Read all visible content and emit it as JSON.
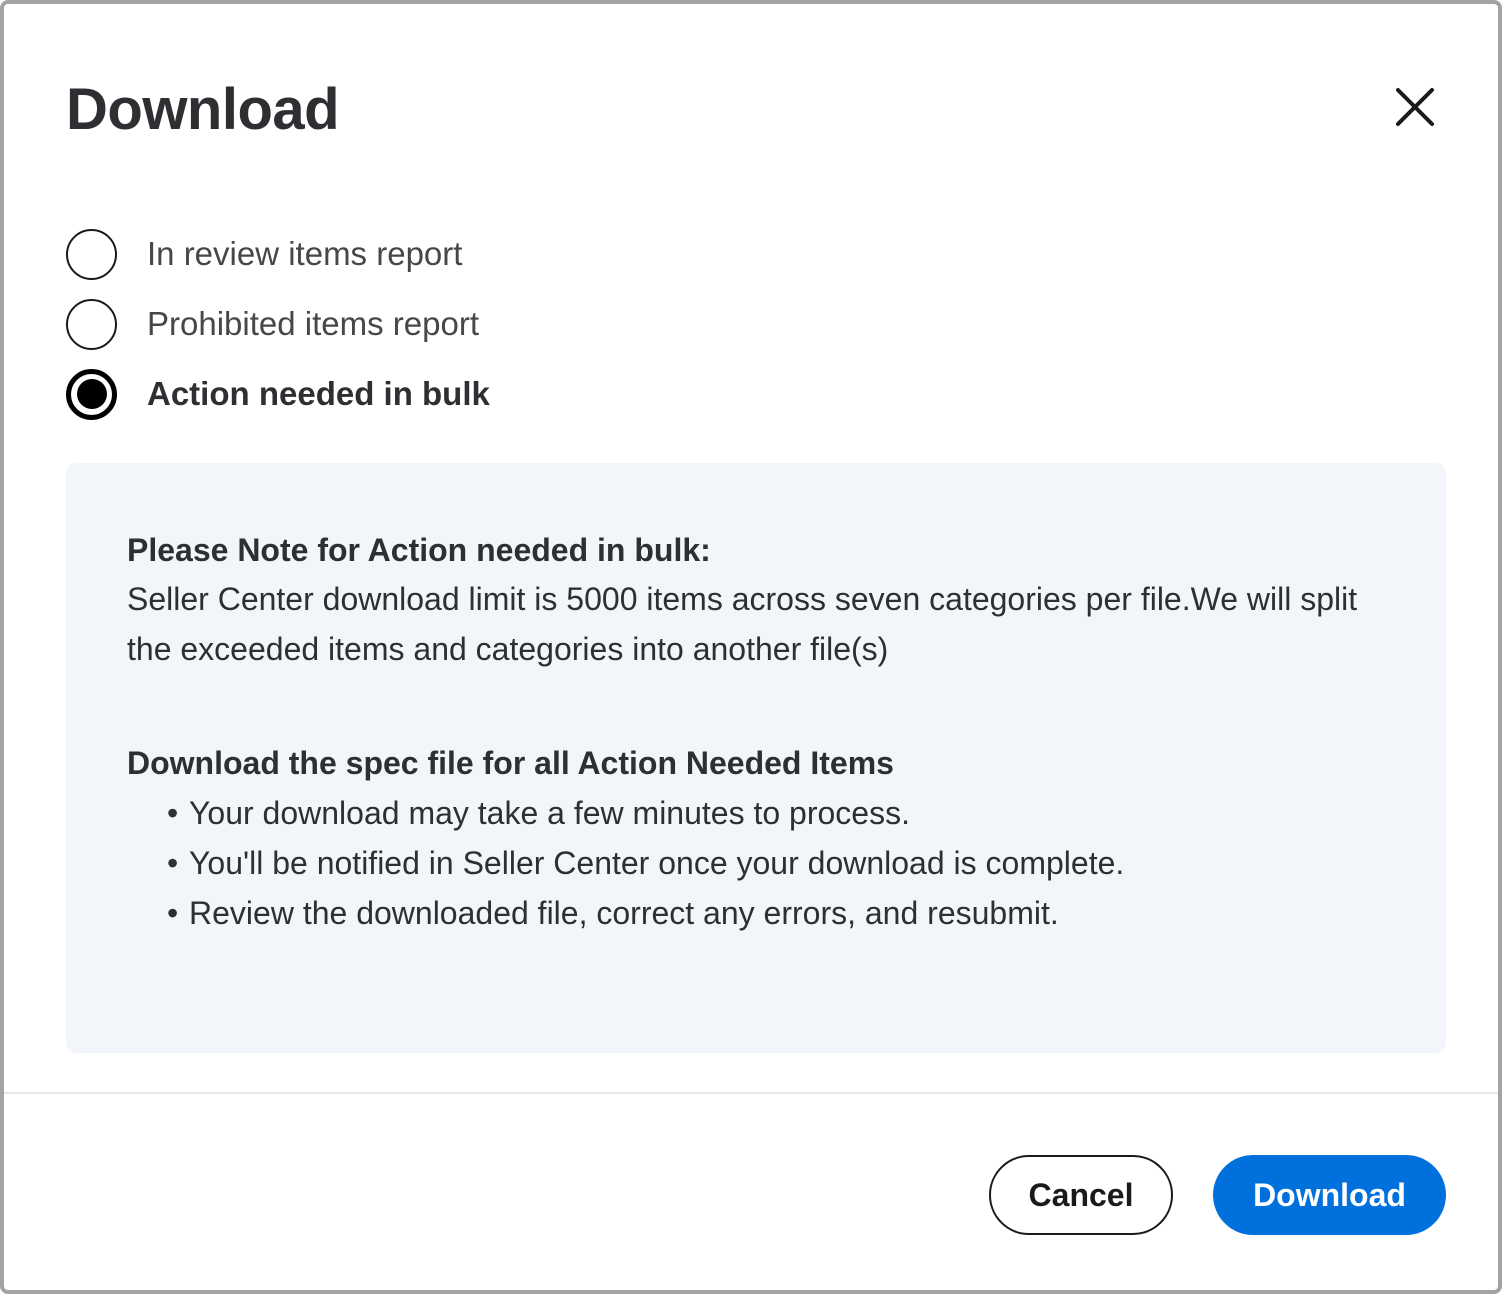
{
  "dialog": {
    "title": "Download",
    "close_icon": "close-icon"
  },
  "options": [
    {
      "label": "In review items report",
      "selected": false
    },
    {
      "label": "Prohibited items report",
      "selected": false
    },
    {
      "label": "Action needed in bulk",
      "selected": true
    }
  ],
  "info": {
    "note_heading": "Please Note for Action needed in bulk:",
    "note_body": "Seller Center download limit is 5000 items across seven categories per file.We will split the exceeded items and categories into another file(s)",
    "spec_heading": "Download the spec file for all Action Needed Items",
    "bullets": [
      "Your download may take a few minutes to process.",
      "You'll be notified in Seller Center once your download is complete.",
      "Review the downloaded file, correct any errors, and resubmit."
    ],
    "bullet_char": "•"
  },
  "footer": {
    "cancel_label": "Cancel",
    "download_label": "Download"
  },
  "colors": {
    "primary": "#0071dc",
    "panel_bg": "#f2f6fa",
    "text": "#2e2f32"
  }
}
